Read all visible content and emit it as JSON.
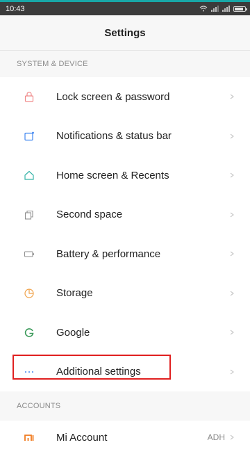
{
  "status_bar": {
    "time": "10:43"
  },
  "header": {
    "title": "Settings"
  },
  "sections": {
    "system": {
      "title": "SYSTEM & DEVICE"
    },
    "accounts": {
      "title": "ACCOUNTS"
    }
  },
  "items": {
    "lock": {
      "label": "Lock screen & password",
      "icon": "lock-icon",
      "color": "#f08a8a"
    },
    "notifications": {
      "label": "Notifications & status bar",
      "icon": "notifications-icon",
      "color": "#3f86f0"
    },
    "home": {
      "label": "Home screen & Recents",
      "icon": "home-icon",
      "color": "#36b3a8"
    },
    "second": {
      "label": "Second space",
      "icon": "second-space-icon",
      "color": "#8f8f8f"
    },
    "battery": {
      "label": "Battery & performance",
      "icon": "battery-icon",
      "color": "#8f8f8f"
    },
    "storage": {
      "label": "Storage",
      "icon": "storage-icon",
      "color": "#f0a24a"
    },
    "google": {
      "label": "Google",
      "icon": "google-icon",
      "color": "#3b9a5a"
    },
    "additional": {
      "label": "Additional settings",
      "icon": "more-dots-icon",
      "color": "#3f86f0"
    },
    "mi": {
      "label": "Mi Account",
      "value": "ADH",
      "icon": "mi-logo-icon",
      "color": "#f07a1f"
    }
  }
}
